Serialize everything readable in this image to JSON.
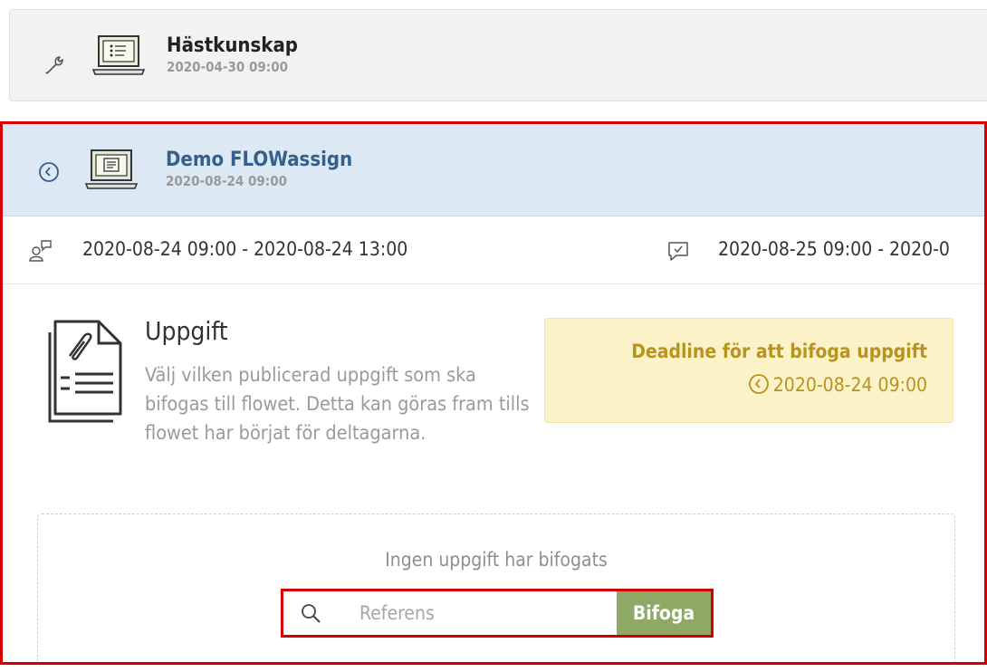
{
  "top_item": {
    "title": "Hästkunskap",
    "date": "2020-04-30 09:00",
    "status_icon": "wrench-icon",
    "type_icon": "laptop-icon"
  },
  "flow_item": {
    "title": "Demo FLOWassign",
    "date": "2020-08-24 09:00",
    "status_icon": "clock-icon",
    "type_icon": "laptop-icon",
    "accent_color": "#35608a",
    "header_bg": "#dce8f3"
  },
  "times": {
    "participation": "2020-08-24 09:00 - 2020-08-24 13:00",
    "review": "2020-08-25 09:00 - 2020-0"
  },
  "task": {
    "title": "Uppgift",
    "description": "Välj vilken publicerad uppgift som ska bifogas till flowet. Detta kan göras fram tills flowet har börjat för deltagarna."
  },
  "deadline": {
    "title": "Deadline för att bifoga uppgift",
    "date": "2020-08-24 09:00",
    "color": "#b7941f",
    "bg": "#fbf2c8"
  },
  "attach": {
    "empty_text": "Ingen uppgift har bifogats",
    "search_placeholder": "Referens",
    "button_label": "Bifoga",
    "button_color": "#8ea865"
  },
  "highlight_color": "#d40000"
}
